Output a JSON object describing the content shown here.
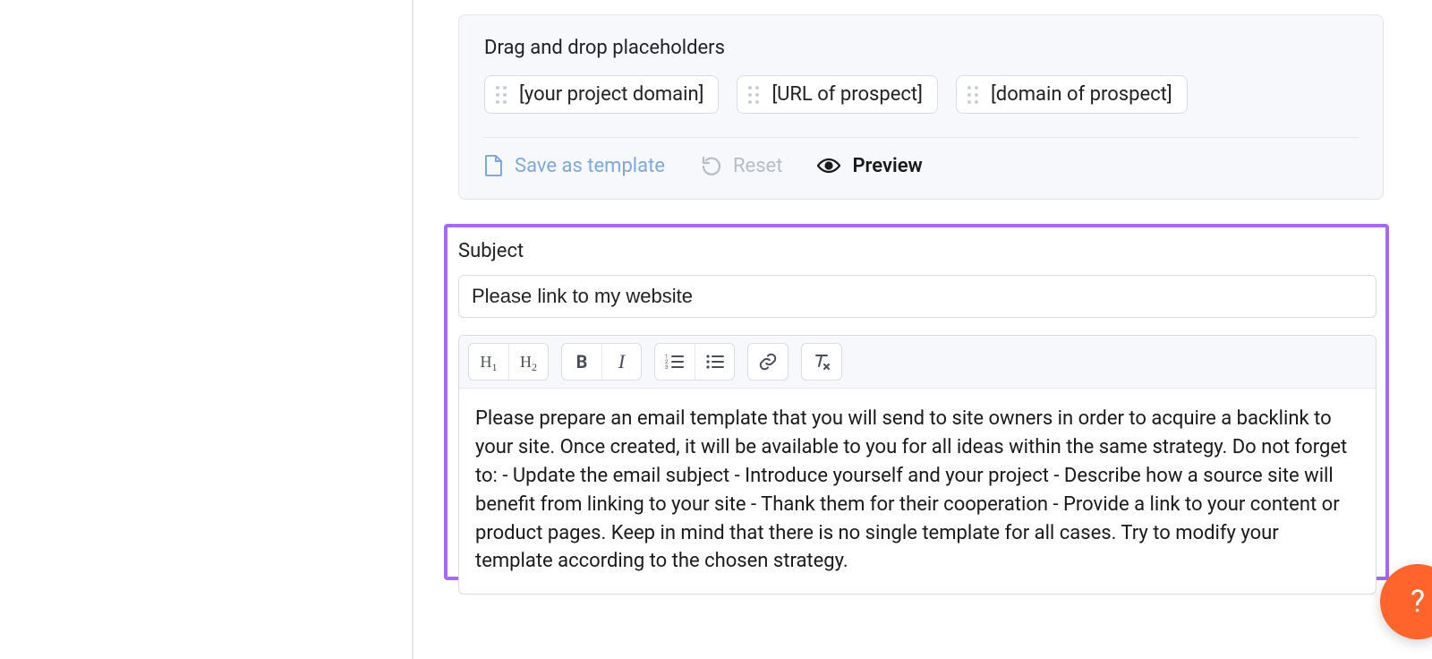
{
  "placeholders": {
    "title": "Drag and drop placeholders",
    "items": [
      "[your project domain]",
      "[URL of prospect]",
      "[domain of prospect]"
    ],
    "actions": {
      "save_template": "Save as template",
      "reset": "Reset",
      "preview": "Preview"
    }
  },
  "subject": {
    "label": "Subject",
    "value": "Please link to my website"
  },
  "editor": {
    "body": "Please prepare an email template that you will send to site owners in order to acquire a backlink to your site. Once created, it will be available to you for all ideas within the same strategy. Do not forget to: - Update the email subject - Introduce yourself and your project - Describe how a source site will benefit from linking to your site - Thank them for their cooperation - Provide a link to your content or product pages. Keep in mind that there is no single template for all cases. Try to modify your template according to the chosen strategy."
  },
  "help": {
    "glyph": "?"
  }
}
